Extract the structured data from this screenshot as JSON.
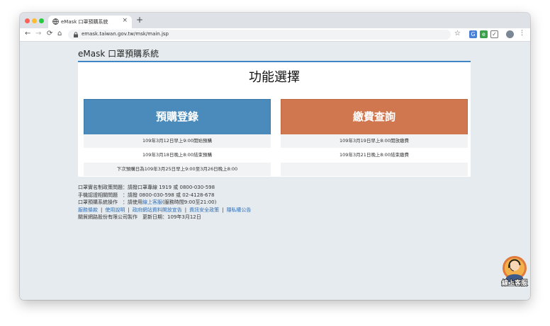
{
  "browser": {
    "tab_title": "eMask 口罩預購系統",
    "tab_close": "×",
    "new_tab": "+",
    "url": "emask.taiwan.gov.tw/msk/main.jsp",
    "nav": {
      "back": "←",
      "forward": "→",
      "reload": "⟳",
      "home": "⌂"
    }
  },
  "header": {
    "brand": "eMask 口罩預購系統"
  },
  "main": {
    "heading": "功能選擇",
    "preorder": {
      "label": "預購登錄",
      "lines": [
        "109年3月12日早上9:00開始預購",
        "109年3月18日晚上8:00結束預購",
        "下次預購日為109年3月25日早上9:00至3月26日晚上8:00"
      ]
    },
    "payment": {
      "label": "繳費查詢",
      "lines": [
        "109年3月19日早上8:00開放繳費",
        "109年3月21日晚上8:00結束繳費"
      ]
    }
  },
  "footer": {
    "line1": "口罩實名制政策問題：請撥口罩專線 1919 或 0800-030-598",
    "line2": "手機認證相關問題　：請撥 0800-030-598 或 02-4128-678",
    "line3_prefix": "口罩預購系統操作　：請使用",
    "line3_link": "線上客服",
    "line3_suffix": "(服務時間9:00至21:00)",
    "links": [
      "服務條款",
      "使用說明",
      "政府網站資料開放宣告",
      "資訊安全政策",
      "隱私權公告"
    ],
    "link_sep": "|",
    "credit": "關貿網路股份有限公司製作　更新日期：109年3月12日"
  },
  "chat_widget": {
    "label": "線上客服",
    "icon": "customer-service-agent-icon"
  },
  "colors": {
    "preorder": "#4a8bbb",
    "payment": "#d1774f",
    "accent": "#3f86c4"
  }
}
